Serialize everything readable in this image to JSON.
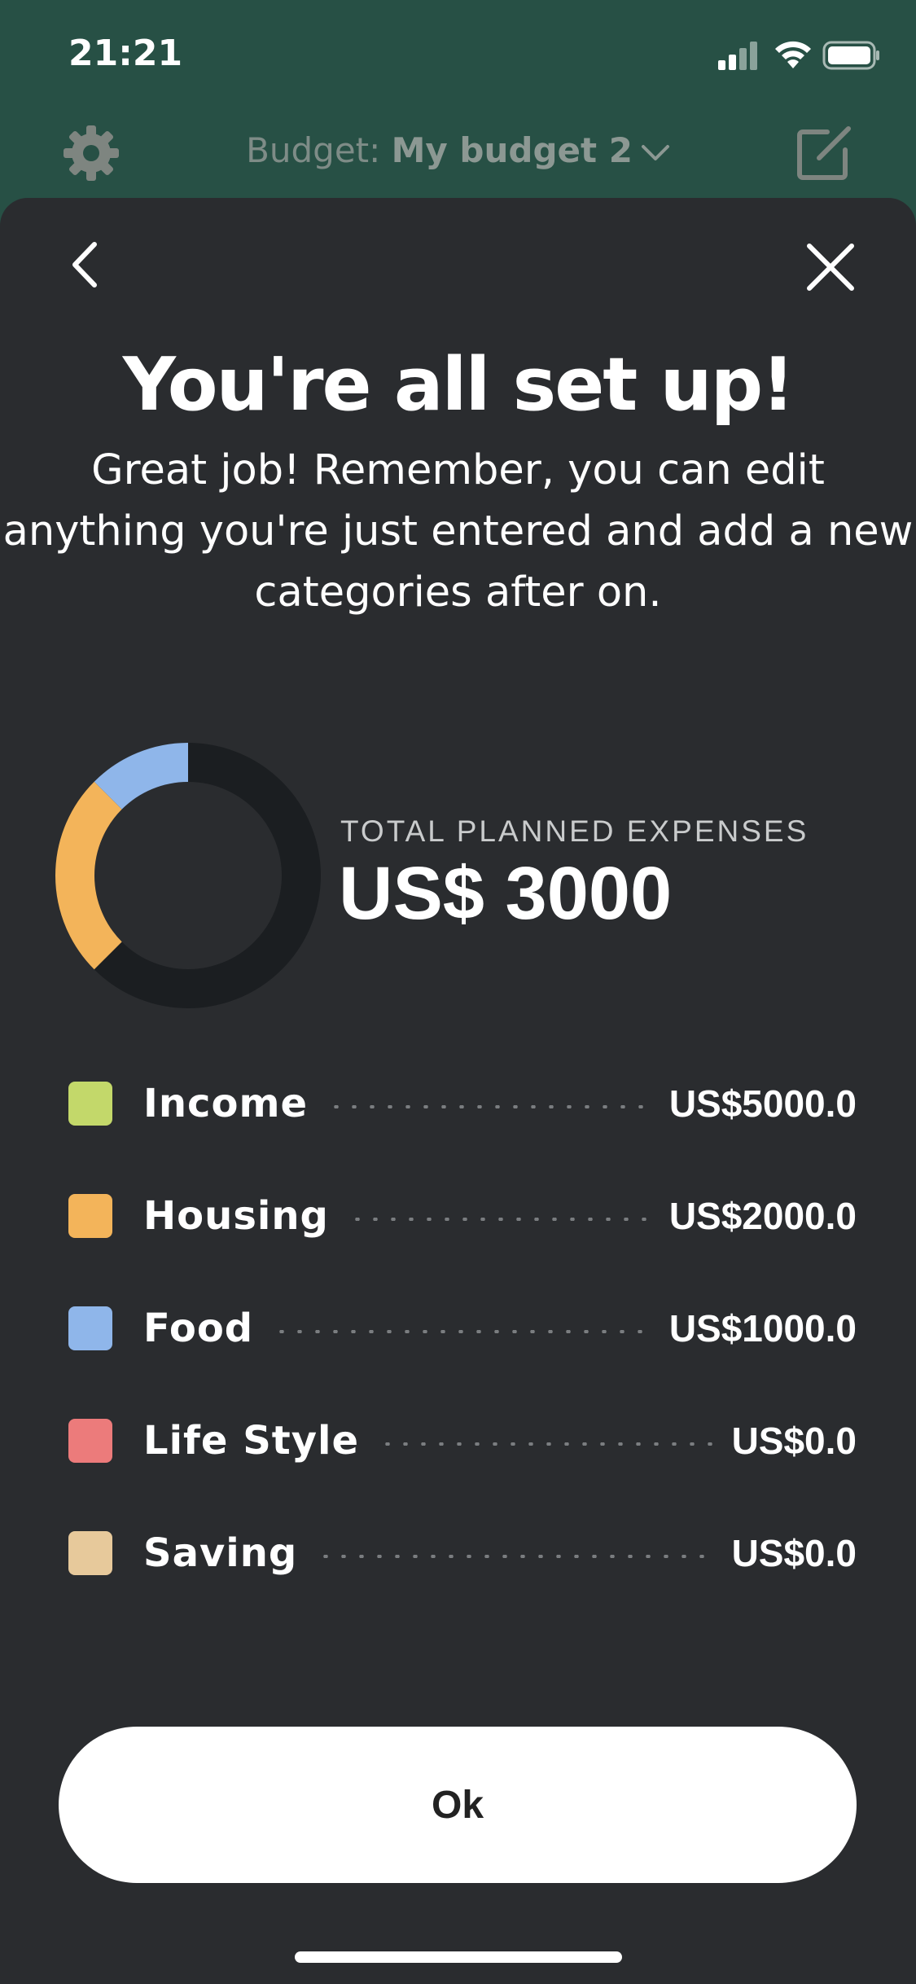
{
  "status_bar": {
    "time": "21:21"
  },
  "header": {
    "budget_prefix": "Budget: ",
    "budget_name": "My budget 2",
    "icons": [
      "gear-icon",
      "chevron-down-icon",
      "edit-icon"
    ]
  },
  "sheet": {
    "title": "You're all set up!",
    "subtitle": "Great job! Remember, you can edit\nanything you're just entered and add a new\ncategories after on.",
    "total_label": "TOTAL PLANNED EXPENSES",
    "total_value": "US$ 3000",
    "categories": [
      {
        "name": "Income",
        "amount": "US$5000.0",
        "color": "#c3d86a"
      },
      {
        "name": "Housing",
        "amount": "US$2000.0",
        "color": "#f3b45a"
      },
      {
        "name": "Food",
        "amount": "US$1000.0",
        "color": "#8fb6ea"
      },
      {
        "name": "Life Style",
        "amount": "US$0.0",
        "color": "#ec7b7b"
      },
      {
        "name": "Saving",
        "amount": "US$0.0",
        "color": "#e7c99b"
      }
    ],
    "ok_label": "Ok"
  },
  "donut": {
    "total": 3000,
    "segments": [
      {
        "name": "Housing",
        "value": 2000,
        "color": "#f3b45a"
      },
      {
        "name": "Food",
        "value": 1000,
        "color": "#8fb6ea"
      }
    ],
    "track_color": "#1b1e21",
    "shown_fraction_of_circle": 0.375
  },
  "colors": {
    "background_green": "#275045",
    "sheet": "#2a2c2f",
    "button": "#ffffff"
  }
}
